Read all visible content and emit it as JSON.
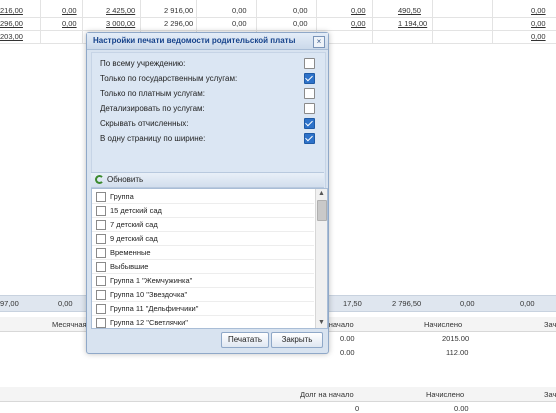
{
  "background": {
    "top_rows": [
      [
        "216,00",
        "0,00",
        "2 425,00",
        "2 916,00",
        "0,00",
        "0,00",
        "0,00",
        "490,50",
        "0,00"
      ],
      [
        "296,00",
        "0,00",
        "3 000,00",
        "2 296,00",
        "0,00",
        "0,00",
        "0,00",
        "1 194,00",
        "0,00"
      ],
      [
        "203,00",
        "",
        "",
        "",
        "",
        "",
        "",
        "",
        "0,00"
      ]
    ],
    "totals_row": [
      "97,00",
      "0,00",
      "17,50",
      "2 796,50",
      "0,00",
      "0,00"
    ],
    "sub_header": {
      "col1": "Месячная с",
      "col2": "Долг на начало",
      "col3": "Начислено",
      "col4": "Зач"
    },
    "sub_rows": [
      [
        "0.00",
        "2015.00"
      ],
      [
        "0.00",
        "112.00"
      ]
    ],
    "bottom_header": {
      "col1": "Долг на начало",
      "col2": "Начислено",
      "col3": "Зач"
    },
    "bottom_row": [
      "0",
      "0.00"
    ]
  },
  "dialog": {
    "title": "Настройки печати ведомости родительской платы",
    "close_glyph": "×",
    "options": [
      {
        "label": "По всему учреждению:",
        "checked": false
      },
      {
        "label": "Только по государственным услугам:",
        "checked": true
      },
      {
        "label": "Только по платным услугам:",
        "checked": false
      },
      {
        "label": "Детализировать по услугам:",
        "checked": false
      },
      {
        "label": "Скрывать отчисленных:",
        "checked": true
      },
      {
        "label": "В одну страницу по ширине:",
        "checked": true
      }
    ],
    "refresh_label": "Обновить",
    "list_items": [
      "Группа",
      "15 детский сад",
      "7 детский сад",
      "9 детский сад",
      "Временные",
      "Выбывшие",
      "Группа 1 \"Жемчужинка\"",
      "Группа 10 \"Звездочка\"",
      "Группа 11 \"Дельфинчики\"",
      "Группа 12 \"Светлячки\""
    ],
    "scroll_up": "▲",
    "scroll_down": "▼",
    "print_button": "Печатать",
    "close_button": "Закрыть"
  }
}
